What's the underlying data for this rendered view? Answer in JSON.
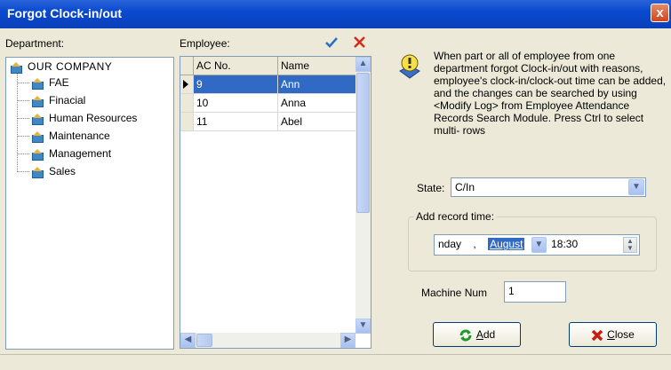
{
  "window": {
    "title": "Forgot Clock-in/out",
    "close_glyph": "x"
  },
  "department": {
    "label": "Department:",
    "root": "OUR COMPANY",
    "items": [
      "FAE",
      "Finacial",
      "Human Resources",
      "Maintenance",
      "Management",
      "Sales"
    ]
  },
  "employee": {
    "label": "Employee:",
    "columns": [
      "AC No.",
      "Name"
    ],
    "rows": [
      {
        "ac": "9",
        "name": "Ann"
      },
      {
        "ac": "10",
        "name": "Anna"
      },
      {
        "ac": "11",
        "name": "Abel"
      }
    ]
  },
  "info_text": "When part or all of employee from one department forgot Clock-in/out with reasons, employee's clock-in/clock-out time can be added, and the changes can be searched by using <Modify Log> from Employee Attendance Records Search Module. Press Ctrl to select multi- rows",
  "state": {
    "label": "State:",
    "value": "C/In"
  },
  "record_time": {
    "label": "Add record time:",
    "day": "nday",
    "sep": ",",
    "month": "August",
    "time": "18:30"
  },
  "machine": {
    "label": "Machine Num",
    "value": "1"
  },
  "buttons": {
    "add": "dd",
    "add_key": "A",
    "close": "lose",
    "close_key": "C"
  },
  "colors": {
    "titlebar": "#0a4ad0",
    "selection": "#316ac5",
    "check": "#2a6fc9",
    "cross": "#d42a1a"
  }
}
